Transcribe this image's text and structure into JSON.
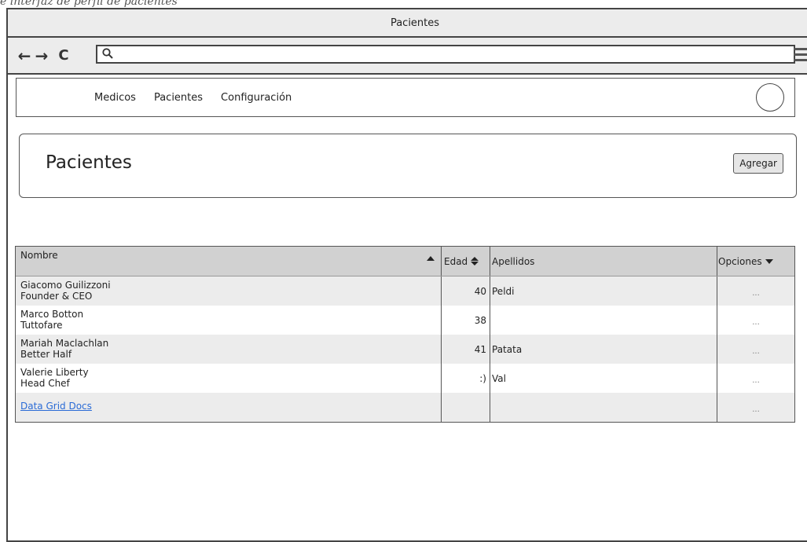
{
  "caption": "e interfaz de perfil de pacientes",
  "window": {
    "title": "Pacientes"
  },
  "toolbar": {
    "back_icon": "arrow-left-icon",
    "forward_icon": "arrow-right-icon",
    "reload_icon": "reload-icon",
    "search_icon": "search-icon",
    "url_value": "",
    "menu_icon": "hamburger-menu-icon"
  },
  "nav": {
    "items": [
      "Medicos",
      "Pacientes",
      "Configuración"
    ],
    "avatar_icon": "avatar-circle"
  },
  "header": {
    "title": "Pacientes",
    "add_label": "Agregar"
  },
  "grid": {
    "columns": {
      "nombre": "Nombre",
      "edad": "Edad",
      "apellidos": "Apellidos",
      "opciones": "Opciones"
    },
    "rows": [
      {
        "name": "Giacomo Guilizzoni",
        "role": "Founder & CEO",
        "edad": "40",
        "apellidos": "Peldi",
        "opciones": "..."
      },
      {
        "name": "Marco Botton",
        "role": "Tuttofare",
        "edad": "38",
        "apellidos": "",
        "opciones": "..."
      },
      {
        "name": "Mariah Maclachlan",
        "role": "Better Half",
        "edad": "41",
        "apellidos": "Patata",
        "opciones": "..."
      },
      {
        "name": "Valerie Liberty",
        "role": "Head Chef",
        "edad": ":)",
        "apellidos": "Val",
        "opciones": "..."
      }
    ],
    "footer_link": "Data Grid Docs",
    "footer_opciones": "..."
  },
  "colors": {
    "row_alt": "#ececec",
    "header_bg": "#d1d1d1",
    "link": "#2a6bd6"
  }
}
